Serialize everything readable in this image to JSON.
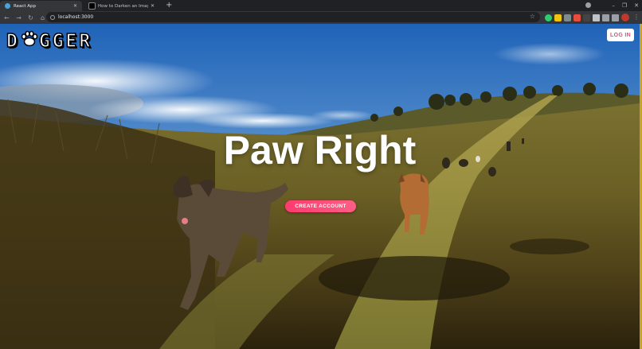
{
  "browser": {
    "tabs": [
      {
        "title": "React App",
        "active": true
      },
      {
        "title": "How to Darken an Image with C",
        "active": false
      }
    ],
    "new_tab_glyph": "+",
    "address": "localhost:3000",
    "window_controls": {
      "minimize": "–",
      "maximize": "❐",
      "close": "✕"
    }
  },
  "page": {
    "brand_left": "D",
    "brand_right": "GGER",
    "login_label": "LOG IN",
    "hero_title": "Paw Right",
    "cta_label": "CREATE ACCOUNT"
  },
  "icons": {
    "brand_paw": "paw-icon",
    "back": "back-arrow-icon",
    "forward": "forward-arrow-icon",
    "reload": "reload-icon",
    "home": "home-icon",
    "bookmark": "star-icon"
  },
  "colors": {
    "accent_pink": "#ff3a6e",
    "login_text": "#e84a7f",
    "chrome_dark": "#202124",
    "chrome_toolbar": "#35363a"
  }
}
